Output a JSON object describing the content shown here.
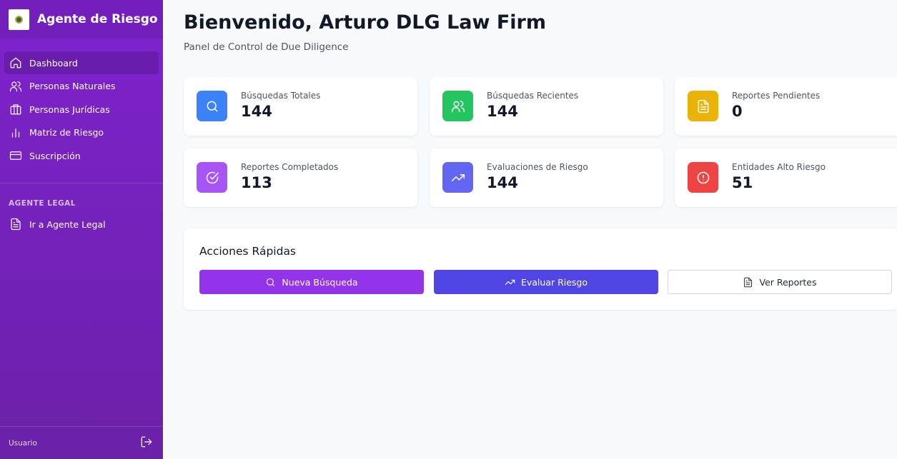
{
  "sidebar": {
    "brand_title": "Agente de Riesgo",
    "nav_items": [
      {
        "label": "Dashboard",
        "icon": "home-icon",
        "active": true
      },
      {
        "label": "Personas Naturales",
        "icon": "users-icon"
      },
      {
        "label": "Personas Jurídicas",
        "icon": "briefcase-icon"
      },
      {
        "label": "Matriz de Riesgo",
        "icon": "bar-chart-icon"
      },
      {
        "label": "Suscripción",
        "icon": "credit-card-icon"
      }
    ],
    "section_label": "AGENTE LEGAL",
    "legal_item": {
      "label": "Ir a Agente Legal",
      "icon": "file-text-icon"
    },
    "footer_user": "Usuario",
    "logout_icon": "logout-icon"
  },
  "header": {
    "welcome": "Bienvenido, Arturo DLG Law Firm",
    "subtitle": "Panel de Control de Due Diligence"
  },
  "stats": [
    {
      "label": "Búsquedas Totales",
      "value": "144",
      "icon": "search-icon",
      "color": "#3b82f6"
    },
    {
      "label": "Búsquedas Recientes",
      "value": "144",
      "icon": "users-icon",
      "color": "#22c55e"
    },
    {
      "label": "Reportes Pendientes",
      "value": "0",
      "icon": "file-text-icon",
      "color": "#eab308"
    },
    {
      "label": "Reportes Completados",
      "value": "113",
      "icon": "check-circle-icon",
      "color": "#a855f7"
    },
    {
      "label": "Evaluaciones de Riesgo",
      "value": "144",
      "icon": "trending-up-icon",
      "color": "#6366f1"
    },
    {
      "label": "Entidades Alto Riesgo",
      "value": "51",
      "icon": "alert-circle-icon",
      "color": "#ef4444"
    }
  ],
  "quick_actions": {
    "title": "Acciones Rápidas",
    "buttons": [
      {
        "label": "Nueva Búsqueda",
        "icon": "search-icon",
        "color": "#9333ea"
      },
      {
        "label": "Evaluar Riesgo",
        "icon": "trending-up-icon",
        "color": "#4f46e5"
      },
      {
        "label": "Ver Reportes",
        "icon": "file-text-icon"
      }
    ]
  }
}
